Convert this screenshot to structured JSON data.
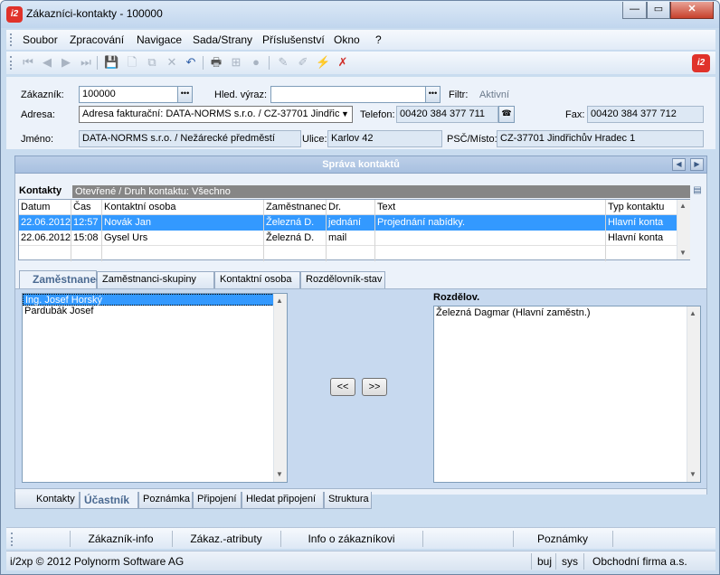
{
  "window": {
    "title": "Zákazníci-kontakty - 100000",
    "logo": "i2",
    "minimize": "—",
    "maximize": "▭",
    "close": "✕"
  },
  "menu": [
    "Soubor",
    "Zpracování",
    "Navigace",
    "Sada/Strany",
    "Příslušenství",
    "Okno",
    "?"
  ],
  "toolbar_icons": [
    "first-record-icon",
    "prev-record-icon",
    "next-record-icon",
    "last-record-icon",
    "save-icon",
    "new-document-icon",
    "copy-icon",
    "delete-icon",
    "undo-icon",
    "print-icon",
    "tree-icon",
    "stop-icon",
    "edit-pen-icon",
    "edit-pen-alt-icon",
    "filter-icon",
    "clear-filter-icon"
  ],
  "form": {
    "zakaznik_label": "Zákazník:",
    "zakaznik_value": "100000",
    "hled_label": "Hled. výraz:",
    "hled_value": "",
    "filtr_label": "Filtr:",
    "filtr_value": "Aktivní",
    "adresa_label": "Adresa:",
    "adresa_value": "Adresa fakturační: DATA-NORMS s.r.o. / CZ-37701 Jindřic",
    "telefon_label": "Telefon:",
    "telefon_value": "00420 384 377 711",
    "fax_label": "Fax:",
    "fax_value": "00420 384 377 712",
    "jmeno_label": "Jméno:",
    "jmeno_value": "DATA-NORMS s.r.o. / Nežárecké předměstí",
    "ulice_label": "Ulice:",
    "ulice_value": "Karlov 42",
    "psc_label": "PSČ/Místo:",
    "psc_value": "CZ-37701 Jindřichův Hradec 1"
  },
  "panel": {
    "title": "Správa kontaktů"
  },
  "contacts": {
    "title": "Kontakty",
    "filter": "Otevřené / Druh kontaktu: Všechno",
    "columns": [
      "Datum",
      "Čas",
      "Kontaktní osoba",
      "Zaměstnanec",
      "Dr.",
      "Text",
      "Typ kontaktu"
    ],
    "rows": [
      [
        "22.06.2012",
        "12:57",
        "Novák Jan",
        "Železná D.",
        "jednání",
        "Projednání nabídky.",
        "Hlavní konta"
      ],
      [
        "22.06.2012",
        "15:08",
        "Gysel Urs",
        "Železná D.",
        "mail",
        "",
        "Hlavní konta"
      ]
    ]
  },
  "subtabs": [
    "Zaměstnanec",
    "Zaměstnanci-skupiny",
    "Kontaktní osoba",
    "Rozdělovník-stav"
  ],
  "employees": [
    "Ing. Josef Horský",
    "Pardubák Josef"
  ],
  "distribution": {
    "title": "Rozdělov.",
    "items": [
      "Železná Dagmar (Hlavní zaměstn.)"
    ]
  },
  "move_buttons": {
    "left": "<<",
    "right": ">>"
  },
  "bottom_tabs": [
    "Kontakty",
    "Účastník",
    "Poznámka",
    "Připojení",
    "Hledat připojení",
    "Struktura"
  ],
  "function_bar": [
    "Zákazník-info",
    "Zákaz.-atributy",
    "Info o zákazníkovi",
    "Poznámky"
  ],
  "status": {
    "copyright": "i/2xp © 2012 Polynorm Software AG",
    "lang": "buj",
    "user": "sys",
    "company": "Obchodní firma a.s."
  }
}
